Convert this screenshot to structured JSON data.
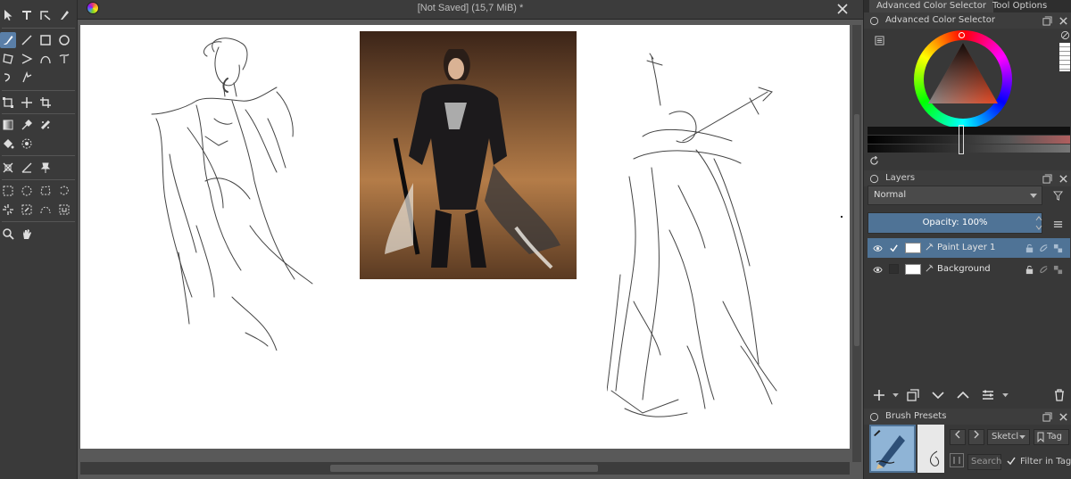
{
  "document": {
    "title": "[Not Saved]  (15,7 MiB) *"
  },
  "dockers": {
    "tabs": [
      "Advanced Color Selector",
      "Tool Options"
    ],
    "color_selector": {
      "title": "Advanced Color Selector"
    },
    "layers": {
      "title": "Layers",
      "blend_mode": "Normal",
      "opacity_label": "Opacity:  100%",
      "items": [
        {
          "name": "Paint Layer 1",
          "selected": true,
          "checked": true
        },
        {
          "name": "Background",
          "selected": false,
          "checked": false
        }
      ]
    },
    "brush_presets": {
      "title": "Brush Presets",
      "tag": "Sketcl",
      "tag_label": "Tag",
      "search_placeholder": "Search",
      "filter_label": "Filter in Tag"
    }
  },
  "colors": {
    "accent": "#4f7396",
    "canvas": "#ffffff",
    "panel": "#383838"
  }
}
